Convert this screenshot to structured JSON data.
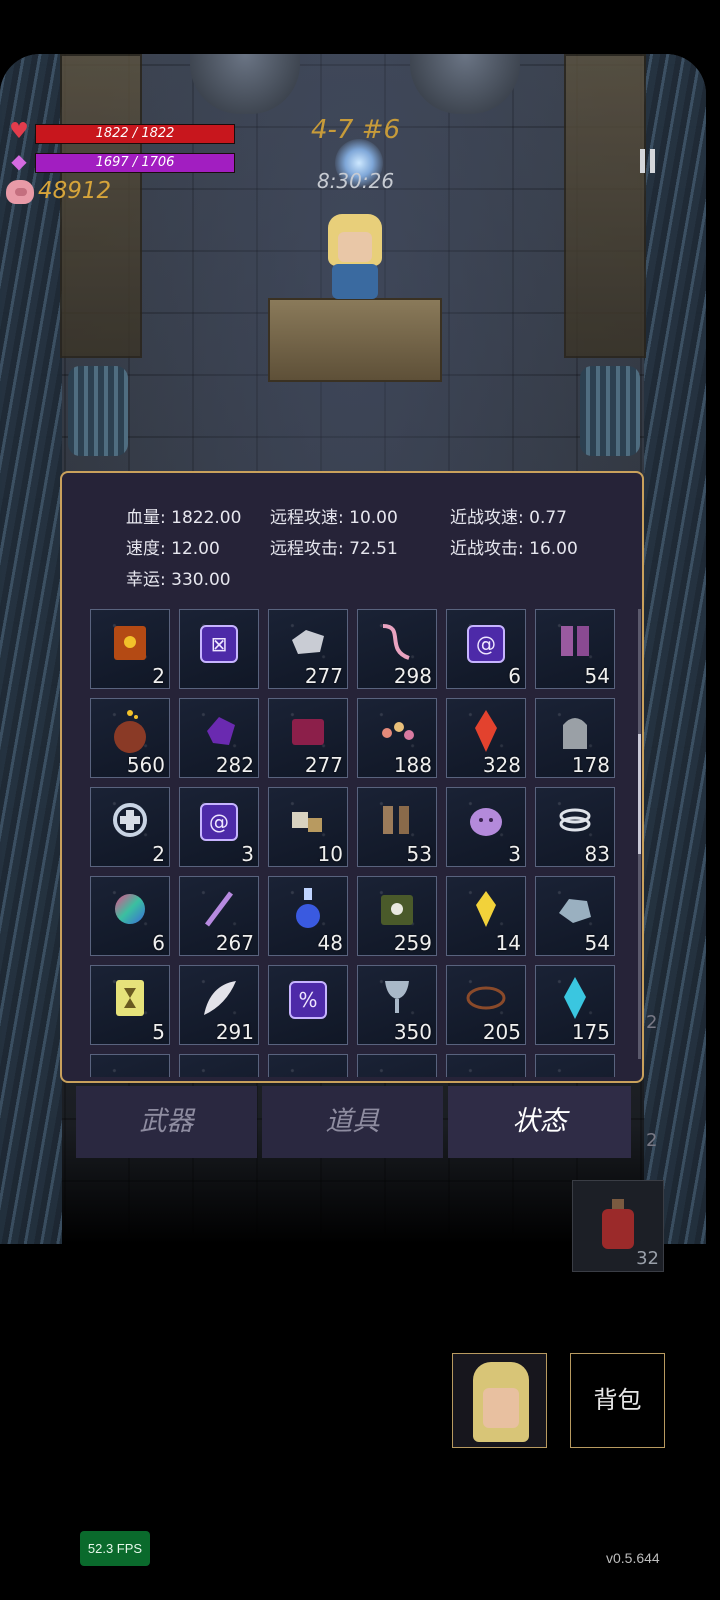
{
  "hud": {
    "hp_text": "1822 / 1822",
    "mp_text": "1697 / 1706",
    "hp_fraction": 1.0,
    "mp_fraction": 0.995,
    "gold": "48912",
    "level": "4-7 #6",
    "timer": "8:30:26"
  },
  "stats": {
    "hp": "血量: 1822.00",
    "ranged_speed": "远程攻速: 10.00",
    "melee_speed": "近战攻速: 0.77",
    "speed": "速度: 12.00",
    "ranged_attack": "远程攻击: 72.51",
    "melee_attack": "近战攻击: 16.00",
    "luck": "幸运: 330.00"
  },
  "inventory": [
    {
      "icon": "spellbook-icon",
      "count": "2"
    },
    {
      "icon": "rune-cross-icon",
      "count": ""
    },
    {
      "icon": "silver-ore-icon",
      "count": "277"
    },
    {
      "icon": "worm-icon",
      "count": "298"
    },
    {
      "icon": "rune-spiral-icon",
      "count": "6"
    },
    {
      "icon": "boots-icon",
      "count": "54"
    },
    {
      "icon": "treasure-sack-icon",
      "count": "560"
    },
    {
      "icon": "purple-crystal-icon",
      "count": "282"
    },
    {
      "icon": "magenta-book-icon",
      "count": "277"
    },
    {
      "icon": "flower-bouquet-icon",
      "count": "188"
    },
    {
      "icon": "red-crystal-icon",
      "count": "328"
    },
    {
      "icon": "tombstone-icon",
      "count": "178"
    },
    {
      "icon": "medkit-ring-icon",
      "count": "2"
    },
    {
      "icon": "rune-spiral-icon",
      "count": "3"
    },
    {
      "icon": "ore-chunks-icon",
      "count": "10"
    },
    {
      "icon": "leather-boots-icon",
      "count": "53"
    },
    {
      "icon": "slime-icon",
      "count": "3"
    },
    {
      "icon": "silver-rings-icon",
      "count": "83"
    },
    {
      "icon": "rainbow-orb-icon",
      "count": "6"
    },
    {
      "icon": "wand-icon",
      "count": "267"
    },
    {
      "icon": "potion-flask-icon",
      "count": "48"
    },
    {
      "icon": "skull-book-icon",
      "count": "259"
    },
    {
      "icon": "yellow-gem-icon",
      "count": "14"
    },
    {
      "icon": "rock-icon",
      "count": "54"
    },
    {
      "icon": "hourglass-card-icon",
      "count": "5"
    },
    {
      "icon": "feather-icon",
      "count": "291"
    },
    {
      "icon": "rune-percent-icon",
      "count": ""
    },
    {
      "icon": "goblet-icon",
      "count": "350"
    },
    {
      "icon": "thorn-crown-icon",
      "count": "205"
    },
    {
      "icon": "cyan-crystal-icon",
      "count": "175"
    },
    {
      "icon": "partial-item-icon",
      "count": ""
    },
    {
      "icon": "partial-item-icon",
      "count": ""
    },
    {
      "icon": "partial-item-icon",
      "count": ""
    },
    {
      "icon": "partial-item-icon",
      "count": ""
    },
    {
      "icon": "partial-item-icon",
      "count": ""
    },
    {
      "icon": "partial-item-icon",
      "count": ""
    }
  ],
  "tabs": {
    "weapons": "武器",
    "items": "道具",
    "status": "状态",
    "active": "status"
  },
  "side": {
    "count_top": "2",
    "count_mid": "2",
    "potion_count": "32"
  },
  "bag_label": "背包",
  "fps": "52.3 FPS",
  "version": "v0.5.644"
}
